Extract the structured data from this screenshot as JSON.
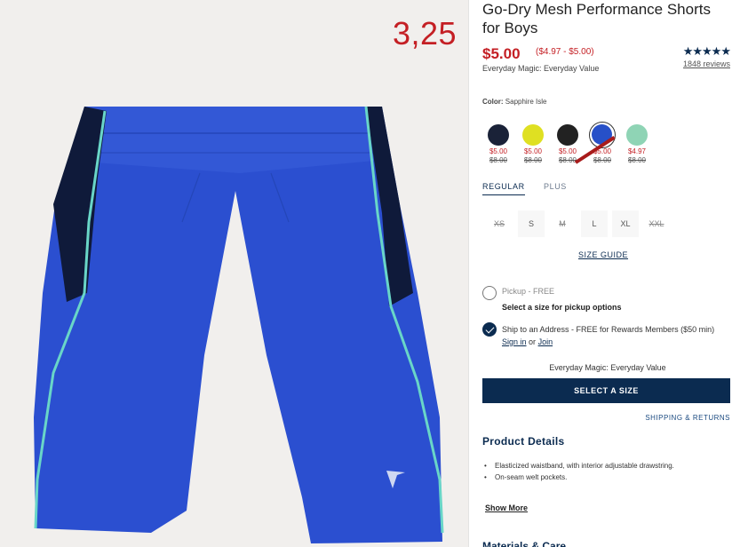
{
  "overlay_number": "3,25",
  "product": {
    "title": "Go-Dry Mesh Performance Shorts for Boys",
    "price": "$5.00",
    "price_range": "($4.97 - $5.00)",
    "everyday_label": "Everyday Magic: Everyday Value",
    "rating_stars": "★★★★★",
    "reviews": "1848 reviews"
  },
  "color": {
    "label": "Color:",
    "selected_name": "Sapphire Isle",
    "swatches": [
      {
        "name": "navy",
        "color": "#1a2238",
        "price": "$5.00",
        "original": "$8.00"
      },
      {
        "name": "yellow",
        "color": "#dfe022",
        "price": "$5.00",
        "original": "$8.00"
      },
      {
        "name": "black",
        "color": "#222222",
        "price": "$5.00",
        "original": "$8.00"
      },
      {
        "name": "sapphire",
        "color": "#2750c8",
        "price": "$5.00",
        "original": "$8.00"
      },
      {
        "name": "mint",
        "color": "#8fd4b5",
        "price": "$4.97",
        "original": "$8.00"
      }
    ]
  },
  "fit_tabs": [
    "REGULAR",
    "PLUS"
  ],
  "sizes": [
    {
      "label": "XS",
      "available": false
    },
    {
      "label": "S",
      "available": true
    },
    {
      "label": "M",
      "available": false
    },
    {
      "label": "L",
      "available": true
    },
    {
      "label": "XL",
      "available": true
    },
    {
      "label": "XXL",
      "available": false
    }
  ],
  "size_guide": "SIZE GUIDE",
  "fulfillment": {
    "pickup": "Pickup - FREE",
    "pickup_sub": "Select a size for pickup options",
    "ship_text": "Ship to an Address - FREE for Rewards Members ($50 min)",
    "sign_in": "Sign in",
    "or": "or",
    "join": "Join"
  },
  "everyday_value": "Everyday Magic: Everyday Value",
  "select_button": "SELECT A SIZE",
  "shipping_returns": "SHIPPING & RETURNS",
  "details": {
    "title": "Product Details",
    "bullets": [
      "Elasticized waistband, with interior adjustable drawstring.",
      "On-seam welt pockets."
    ],
    "show_more": "Show More"
  },
  "materials_title": "Materials & Care",
  "colors": {
    "accent_red": "#c41f24",
    "navy": "#0b2b50",
    "shorts_blue": "#2b4fd0"
  }
}
